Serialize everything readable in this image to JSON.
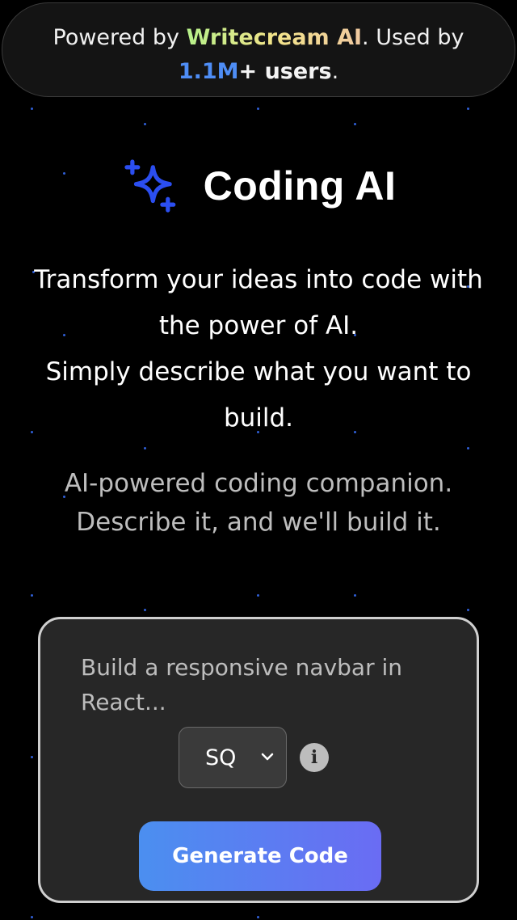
{
  "banner": {
    "prefix": "Powered by ",
    "brand": "Writecream AI",
    "middle": ". Used by",
    "count": "1.1M",
    "users": "+ users",
    "suffix": "."
  },
  "app": {
    "title": "Coding AI",
    "icon": "sparkle-icon",
    "accent": "#2b4ef0"
  },
  "intro": {
    "line1": "Transform your ideas into code with the power of AI.",
    "line2": "Simply describe what you want to build."
  },
  "tagline": {
    "line1": "AI-powered coding companion.",
    "line2": "Describe it, and we'll build it."
  },
  "form": {
    "prompt_placeholder": "Build a responsive navbar in React...",
    "prompt_value": "",
    "language_selected": "SQ",
    "info_icon": "info-icon",
    "generate_label": "Generate Code"
  },
  "colors": {
    "background": "#000000",
    "card": "#272727",
    "button_start": "#4b8ff0",
    "button_end": "#6a6cf3",
    "count": "#4e8df5",
    "star": "#2f5fd6"
  }
}
